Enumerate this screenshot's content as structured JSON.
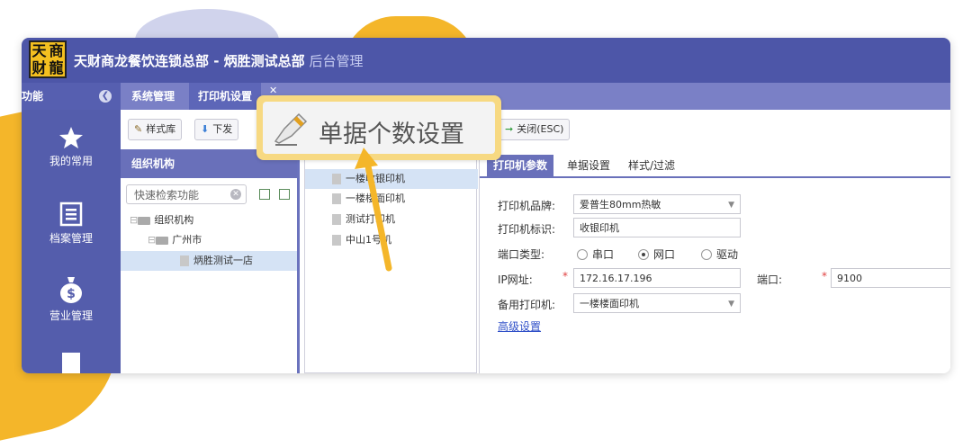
{
  "app": {
    "logo_chars": [
      "天",
      "商",
      "财",
      "龍"
    ],
    "title_main": "天财商龙餐饮连锁总部 - 炳胜测试总部",
    "title_sub": " 后台管理"
  },
  "func_head": {
    "label": "功能"
  },
  "tabs": [
    {
      "label": "系统管理"
    },
    {
      "label": "打印机设置"
    }
  ],
  "sidenav": [
    {
      "label": "我的常用",
      "icon": "star-icon"
    },
    {
      "label": "档案管理",
      "icon": "document-icon"
    },
    {
      "label": "营业管理",
      "icon": "money-bag-icon"
    }
  ],
  "toolbar": {
    "style_lib": "样式库",
    "download": "下发",
    "close": "关闭(ESC)"
  },
  "org": {
    "title": "组织机构",
    "search_placeholder": "快速检索功能",
    "tree": [
      {
        "label": "组织机构"
      },
      {
        "label": "广州市"
      },
      {
        "label": "炳胜测试一店"
      }
    ]
  },
  "printers": {
    "items": [
      {
        "label": "一楼收银印机"
      },
      {
        "label": "一楼楼面印机"
      },
      {
        "label": "测试打印机"
      },
      {
        "label": "中山1号机"
      }
    ]
  },
  "params": {
    "tabs": [
      "打印机参数",
      "单据设置",
      "样式/过滤"
    ],
    "brand_label": "打印机品牌:",
    "brand_value": "爱普生80mm热敏",
    "tag_label": "打印机标识:",
    "tag_value": "收银印机",
    "port_type_label": "端口类型:",
    "port_types": [
      "串口",
      "网口",
      "驱动"
    ],
    "port_type_selected": "网口",
    "ip_label": "IP网址:",
    "ip_value": "172.16.17.196",
    "port_label": "端口:",
    "port_value": "9100",
    "backup_label": "备用打印机:",
    "backup_value": "一楼楼面印机",
    "advanced": "高级设置",
    "required_mark": "*"
  },
  "callout": {
    "text": "单据个数设置"
  },
  "colors": {
    "topbar": "#4d56a8",
    "sidenav": "#545dac",
    "accent_yellow": "#f4b62a",
    "selected_row": "#d5e3f5"
  }
}
